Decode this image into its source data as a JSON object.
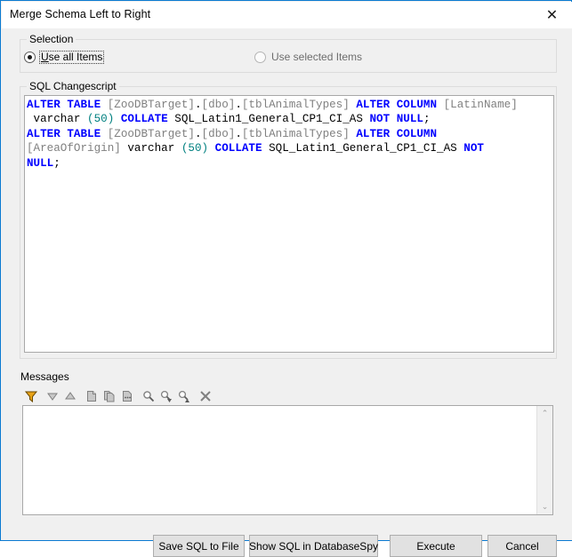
{
  "window": {
    "title": "Merge Schema Left to Right",
    "close_glyph": "✕",
    "border_color": "#0a7ad1"
  },
  "selection": {
    "legend": "Selection",
    "options": [
      {
        "label_prefix": "U",
        "label_rest": "se all Items",
        "label": "Use all Items",
        "checked": true,
        "enabled": true
      },
      {
        "label": "Use selected Items",
        "checked": false,
        "enabled": false
      }
    ]
  },
  "sql_changescript": {
    "legend": "SQL Changescript",
    "lines": [
      [
        {
          "t": "ALTER TABLE ",
          "c": "kw"
        },
        {
          "t": "[ZooDBTarget]",
          "c": "ident"
        },
        {
          "t": ".",
          "c": "plain"
        },
        {
          "t": "[dbo]",
          "c": "ident"
        },
        {
          "t": ".",
          "c": "plain"
        },
        {
          "t": "[tblAnimalTypes]",
          "c": "ident"
        },
        {
          "t": " ",
          "c": "plain"
        },
        {
          "t": "ALTER COLUMN",
          "c": "kw"
        },
        {
          "t": " ",
          "c": "plain"
        },
        {
          "t": "[LatinName]",
          "c": "ident"
        }
      ],
      [
        {
          "t": " varchar ",
          "c": "plain"
        },
        {
          "t": "(50)",
          "c": "num"
        },
        {
          "t": " ",
          "c": "plain"
        },
        {
          "t": "COLLATE",
          "c": "kw"
        },
        {
          "t": " SQL_Latin1_General_CP1_CI_AS ",
          "c": "plain"
        },
        {
          "t": "NOT NULL",
          "c": "kw"
        },
        {
          "t": ";",
          "c": "plain"
        }
      ],
      [
        {
          "t": "ALTER TABLE ",
          "c": "kw"
        },
        {
          "t": "[ZooDBTarget]",
          "c": "ident"
        },
        {
          "t": ".",
          "c": "plain"
        },
        {
          "t": "[dbo]",
          "c": "ident"
        },
        {
          "t": ".",
          "c": "plain"
        },
        {
          "t": "[tblAnimalTypes]",
          "c": "ident"
        },
        {
          "t": " ",
          "c": "plain"
        },
        {
          "t": "ALTER COLUMN",
          "c": "kw"
        }
      ],
      [
        {
          "t": "[AreaOfOrigin]",
          "c": "ident"
        },
        {
          "t": " varchar ",
          "c": "plain"
        },
        {
          "t": "(50)",
          "c": "num"
        },
        {
          "t": " ",
          "c": "plain"
        },
        {
          "t": "COLLATE",
          "c": "kw"
        },
        {
          "t": " SQL_Latin1_General_CP1_CI_AS ",
          "c": "plain"
        },
        {
          "t": "NOT",
          "c": "kw"
        }
      ],
      [
        {
          "t": "NULL",
          "c": "kw"
        },
        {
          "t": ";",
          "c": "plain"
        }
      ]
    ]
  },
  "messages": {
    "legend": "Messages",
    "toolbar": [
      {
        "name": "filter-icon",
        "title": "Filter"
      },
      {
        "name": "next-message-icon",
        "title": "Next"
      },
      {
        "name": "previous-message-icon",
        "title": "Previous"
      },
      {
        "name": "copy-icon",
        "title": "Copy"
      },
      {
        "name": "copy-all-icon",
        "title": "Copy All"
      },
      {
        "name": "copy-with-children-icon",
        "title": "Copy With Children"
      },
      {
        "name": "find-icon",
        "title": "Find"
      },
      {
        "name": "find-next-icon",
        "title": "Find Next"
      },
      {
        "name": "find-previous-icon",
        "title": "Find Previous"
      },
      {
        "name": "clear-icon",
        "title": "Clear"
      }
    ],
    "content": "",
    "scrollbar_up_glyph": "⌃",
    "scrollbar_down_glyph": "⌄"
  },
  "footer": {
    "save_sql_to_file": "Save SQL to File",
    "show_sql_in_databasespy": "Show SQL in DatabaseSpy",
    "execute": "Execute",
    "cancel": "Cancel"
  }
}
